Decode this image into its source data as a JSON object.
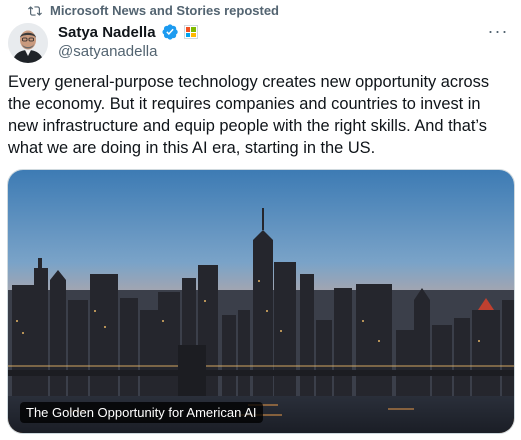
{
  "repost": {
    "text": "Microsoft News and Stories reposted",
    "icon": "repost-icon"
  },
  "author": {
    "display_name": "Satya Nadella",
    "handle": "@satyanadella",
    "verified_icon": "verified-badge-icon",
    "affiliate_icon": "microsoft-logo-icon"
  },
  "menu": {
    "more_label": "···"
  },
  "post": {
    "text": "Every general-purpose technology creates new opportunity across the economy. But it requires companies and countries to invest in new infrastructure and equip people with the right skills. And that’s what we are doing in this AI era, starting in the US."
  },
  "link_card": {
    "title": "The Golden Opportunity for American AI",
    "image": "city-skyline-sunset-image"
  },
  "colors": {
    "verified_blue": "#1d9bf0",
    "secondary_text": "#536471",
    "ms_red": "#f25022",
    "ms_green": "#7fba00",
    "ms_blue": "#00a4ef",
    "ms_yellow": "#ffb900"
  }
}
